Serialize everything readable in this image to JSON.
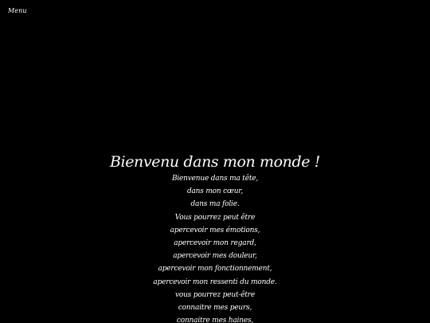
{
  "nav": {
    "menu_label": "Menu"
  },
  "poem": {
    "title": "Bienvenu dans mon monde !",
    "lines": [
      "Bienvenue dans ma tête,",
      "dans mon cœur,",
      "dans ma folie.",
      "Vous pourrez peut être",
      "apercevoir mes émotions,",
      "apercevoir mon regard,",
      "apercevoir mes douleur,",
      "apercevoir mon fonctionnement,",
      "apercevoir mon ressenti du monde.",
      "vous pourrez peut-être",
      "connaitre mes peurs,",
      "connaitre mes haines,"
    ]
  },
  "colors": {
    "background": "#000000",
    "text": "#ffffff"
  }
}
